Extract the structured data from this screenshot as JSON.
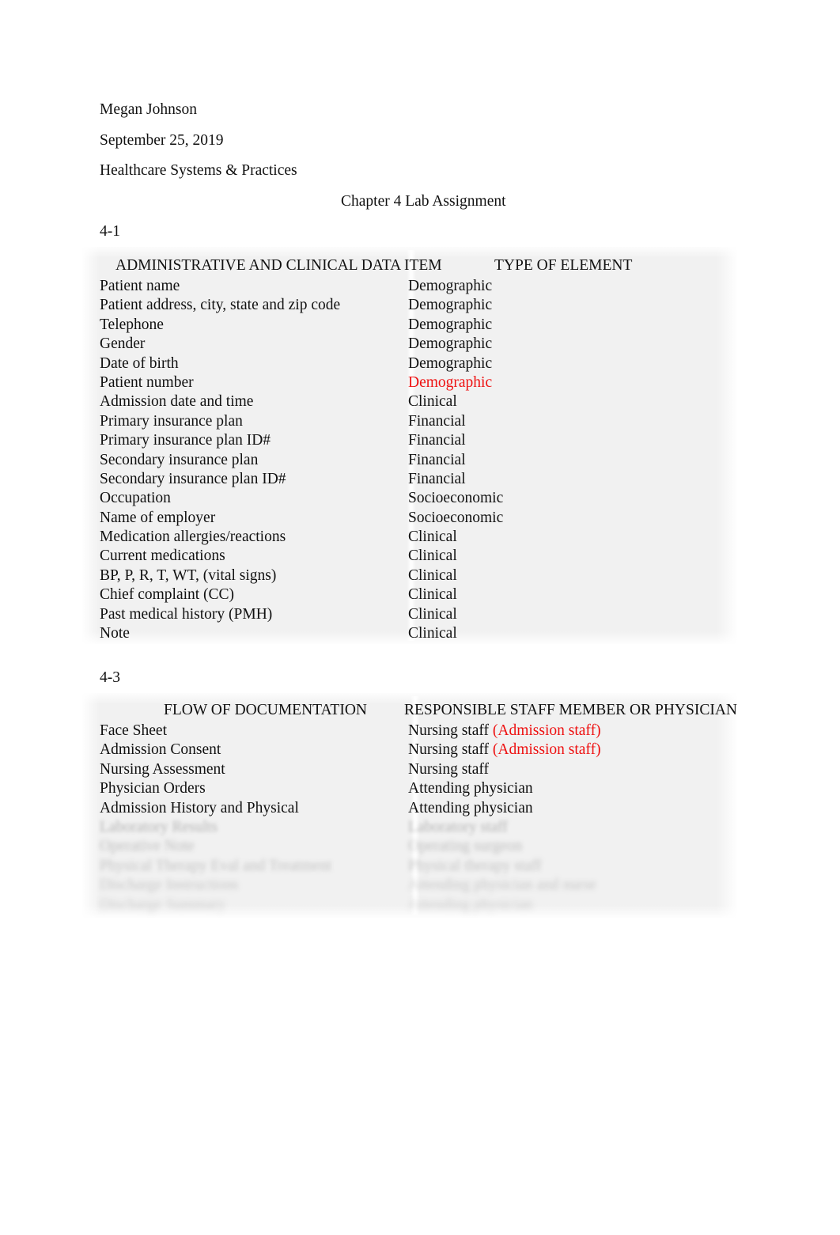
{
  "document": {
    "author": "Megan Johnson",
    "date": "September 25, 2019",
    "course": "Healthcare Systems & Practices",
    "title": "Chapter 4 Lab Assignment"
  },
  "colors": {
    "text": "#111111",
    "highlight_red": "#ee1111",
    "table_background": "#f1f1f1",
    "page_background": "#ffffff"
  },
  "sections": [
    {
      "label": "4-1",
      "table": {
        "headers": [
          "ADMINISTRATIVE AND CLINICAL DATA ITEM",
          "TYPE OF ELEMENT"
        ],
        "rows": [
          {
            "item": "Patient name",
            "type": "Demographic",
            "type_color": "black"
          },
          {
            "item": "Patient address, city, state and zip code",
            "type": "Demographic",
            "type_color": "black"
          },
          {
            "item": "Telephone",
            "type": "Demographic",
            "type_color": "black"
          },
          {
            "item": "Gender",
            "type": "Demographic",
            "type_color": "black"
          },
          {
            "item": "Date of birth",
            "type": "Demographic",
            "type_color": "black"
          },
          {
            "item": "Patient number",
            "type": "Demographic",
            "type_color": "red"
          },
          {
            "item": "Admission date and time",
            "type": "Clinical",
            "type_color": "black"
          },
          {
            "item": "Primary insurance plan",
            "type": "Financial",
            "type_color": "black"
          },
          {
            "item": "Primary insurance plan ID#",
            "type": "Financial",
            "type_color": "black"
          },
          {
            "item": "Secondary insurance plan",
            "type": "Financial",
            "type_color": "black"
          },
          {
            "item": "Secondary insurance plan ID#",
            "type": "Financial",
            "type_color": "black"
          },
          {
            "item": "Occupation",
            "type": "Socioeconomic",
            "type_color": "black"
          },
          {
            "item": "Name of employer",
            "type": "Socioeconomic",
            "type_color": "black"
          },
          {
            "item": "Medication allergies/reactions",
            "type": "Clinical",
            "type_color": "black"
          },
          {
            "item": "Current medications",
            "type": "Clinical",
            "type_color": "black"
          },
          {
            "item": "BP, P, R, T, WT, (vital signs)",
            "type": "Clinical",
            "type_color": "black"
          },
          {
            "item": "Chief complaint (CC)",
            "type": "Clinical",
            "type_color": "black"
          },
          {
            "item": "Past medical history (PMH)",
            "type": "Clinical",
            "type_color": "black"
          },
          {
            "item": "Note",
            "type": "Clinical",
            "type_color": "black"
          }
        ]
      }
    },
    {
      "label": "4-3",
      "table": {
        "headers": [
          "FLOW OF DOCUMENTATION",
          "RESPONSIBLE STAFF MEMBER OR PHYSICIAN"
        ],
        "rows": [
          {
            "item": "Face Sheet",
            "staff": "Nursing staff ",
            "staff_note": "(Admission staff)",
            "faded": false
          },
          {
            "item": "Admission Consent",
            "staff": "Nursing staff ",
            "staff_note": "(Admission staff)",
            "faded": false
          },
          {
            "item": "Nursing Assessment",
            "staff": "Nursing staff",
            "staff_note": "",
            "faded": false
          },
          {
            "item": "Physician Orders",
            "staff": "Attending physician",
            "staff_note": "",
            "faded": false
          },
          {
            "item": "Admission History and Physical",
            "staff": "Attending physician",
            "staff_note": "",
            "faded": false
          },
          {
            "item": "Laboratory Results",
            "staff": "Laboratory staff",
            "staff_note": "",
            "faded": true
          },
          {
            "item": "Operative Note",
            "staff": "Operating surgeon",
            "staff_note": "",
            "faded": true
          },
          {
            "item": "Physical Therapy Eval and Treatment",
            "staff": "Physical therapy staff",
            "staff_note": "",
            "faded": true
          },
          {
            "item": "Discharge Instructions",
            "staff": "Attending physician and nurse",
            "staff_note": "",
            "faded": true
          },
          {
            "item": "Discharge Summary",
            "staff": "Attending physician",
            "staff_note": "",
            "faded": true
          }
        ]
      }
    }
  ]
}
